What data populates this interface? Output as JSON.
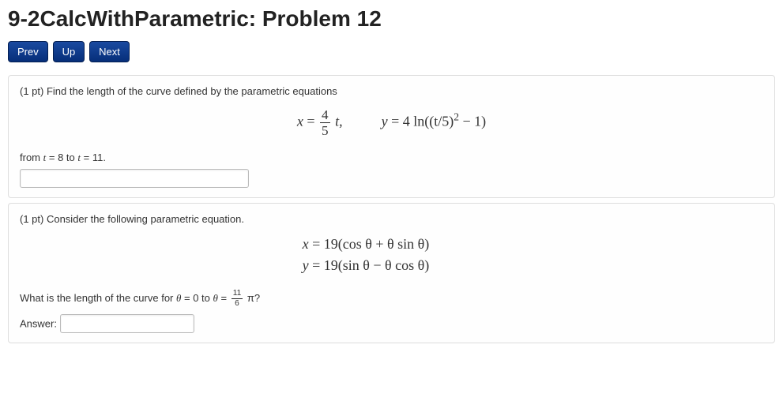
{
  "page_title": "9-2CalcWithParametric: Problem 12",
  "nav": {
    "prev": "Prev",
    "up": "Up",
    "next": "Next"
  },
  "problem1": {
    "prompt_prefix": "(1 pt) Find the length of the curve defined by the parametric equations",
    "eq_x_lhs": "x",
    "eq_x_eq": "=",
    "eq_x_frac_num": "4",
    "eq_x_frac_den": "5",
    "eq_x_var": "t",
    "eq_x_comma": ",",
    "eq_y_lhs": "y",
    "eq_y_eq": "=",
    "eq_y_full": "4 ln((t/5)",
    "eq_y_exp": "2",
    "eq_y_tail": " − 1)",
    "from_text_a": "from ",
    "from_var1": "t",
    "from_eq1": " = 8",
    "from_text_b": " to ",
    "from_var2": "t",
    "from_eq2": " = 11",
    "from_period": "."
  },
  "problem2": {
    "prompt_prefix": "(1 pt) Consider the following parametric equation.",
    "eq1_lhs": "x",
    "eq1_eq": " = ",
    "eq1_rhs": "19(cos θ + θ sin θ)",
    "eq2_lhs": "y",
    "eq2_eq": " = ",
    "eq2_rhs": "19(sin θ − θ cos θ)",
    "q_text_a": "What is the length of the curve for ",
    "q_theta1": "θ",
    "q_eq1": " = 0",
    "q_text_b": " to ",
    "q_theta2": "θ",
    "q_eq2": " = ",
    "q_frac_num": "11",
    "q_frac_den": "6",
    "q_pi": " π?",
    "answer_label": "Answer:"
  }
}
